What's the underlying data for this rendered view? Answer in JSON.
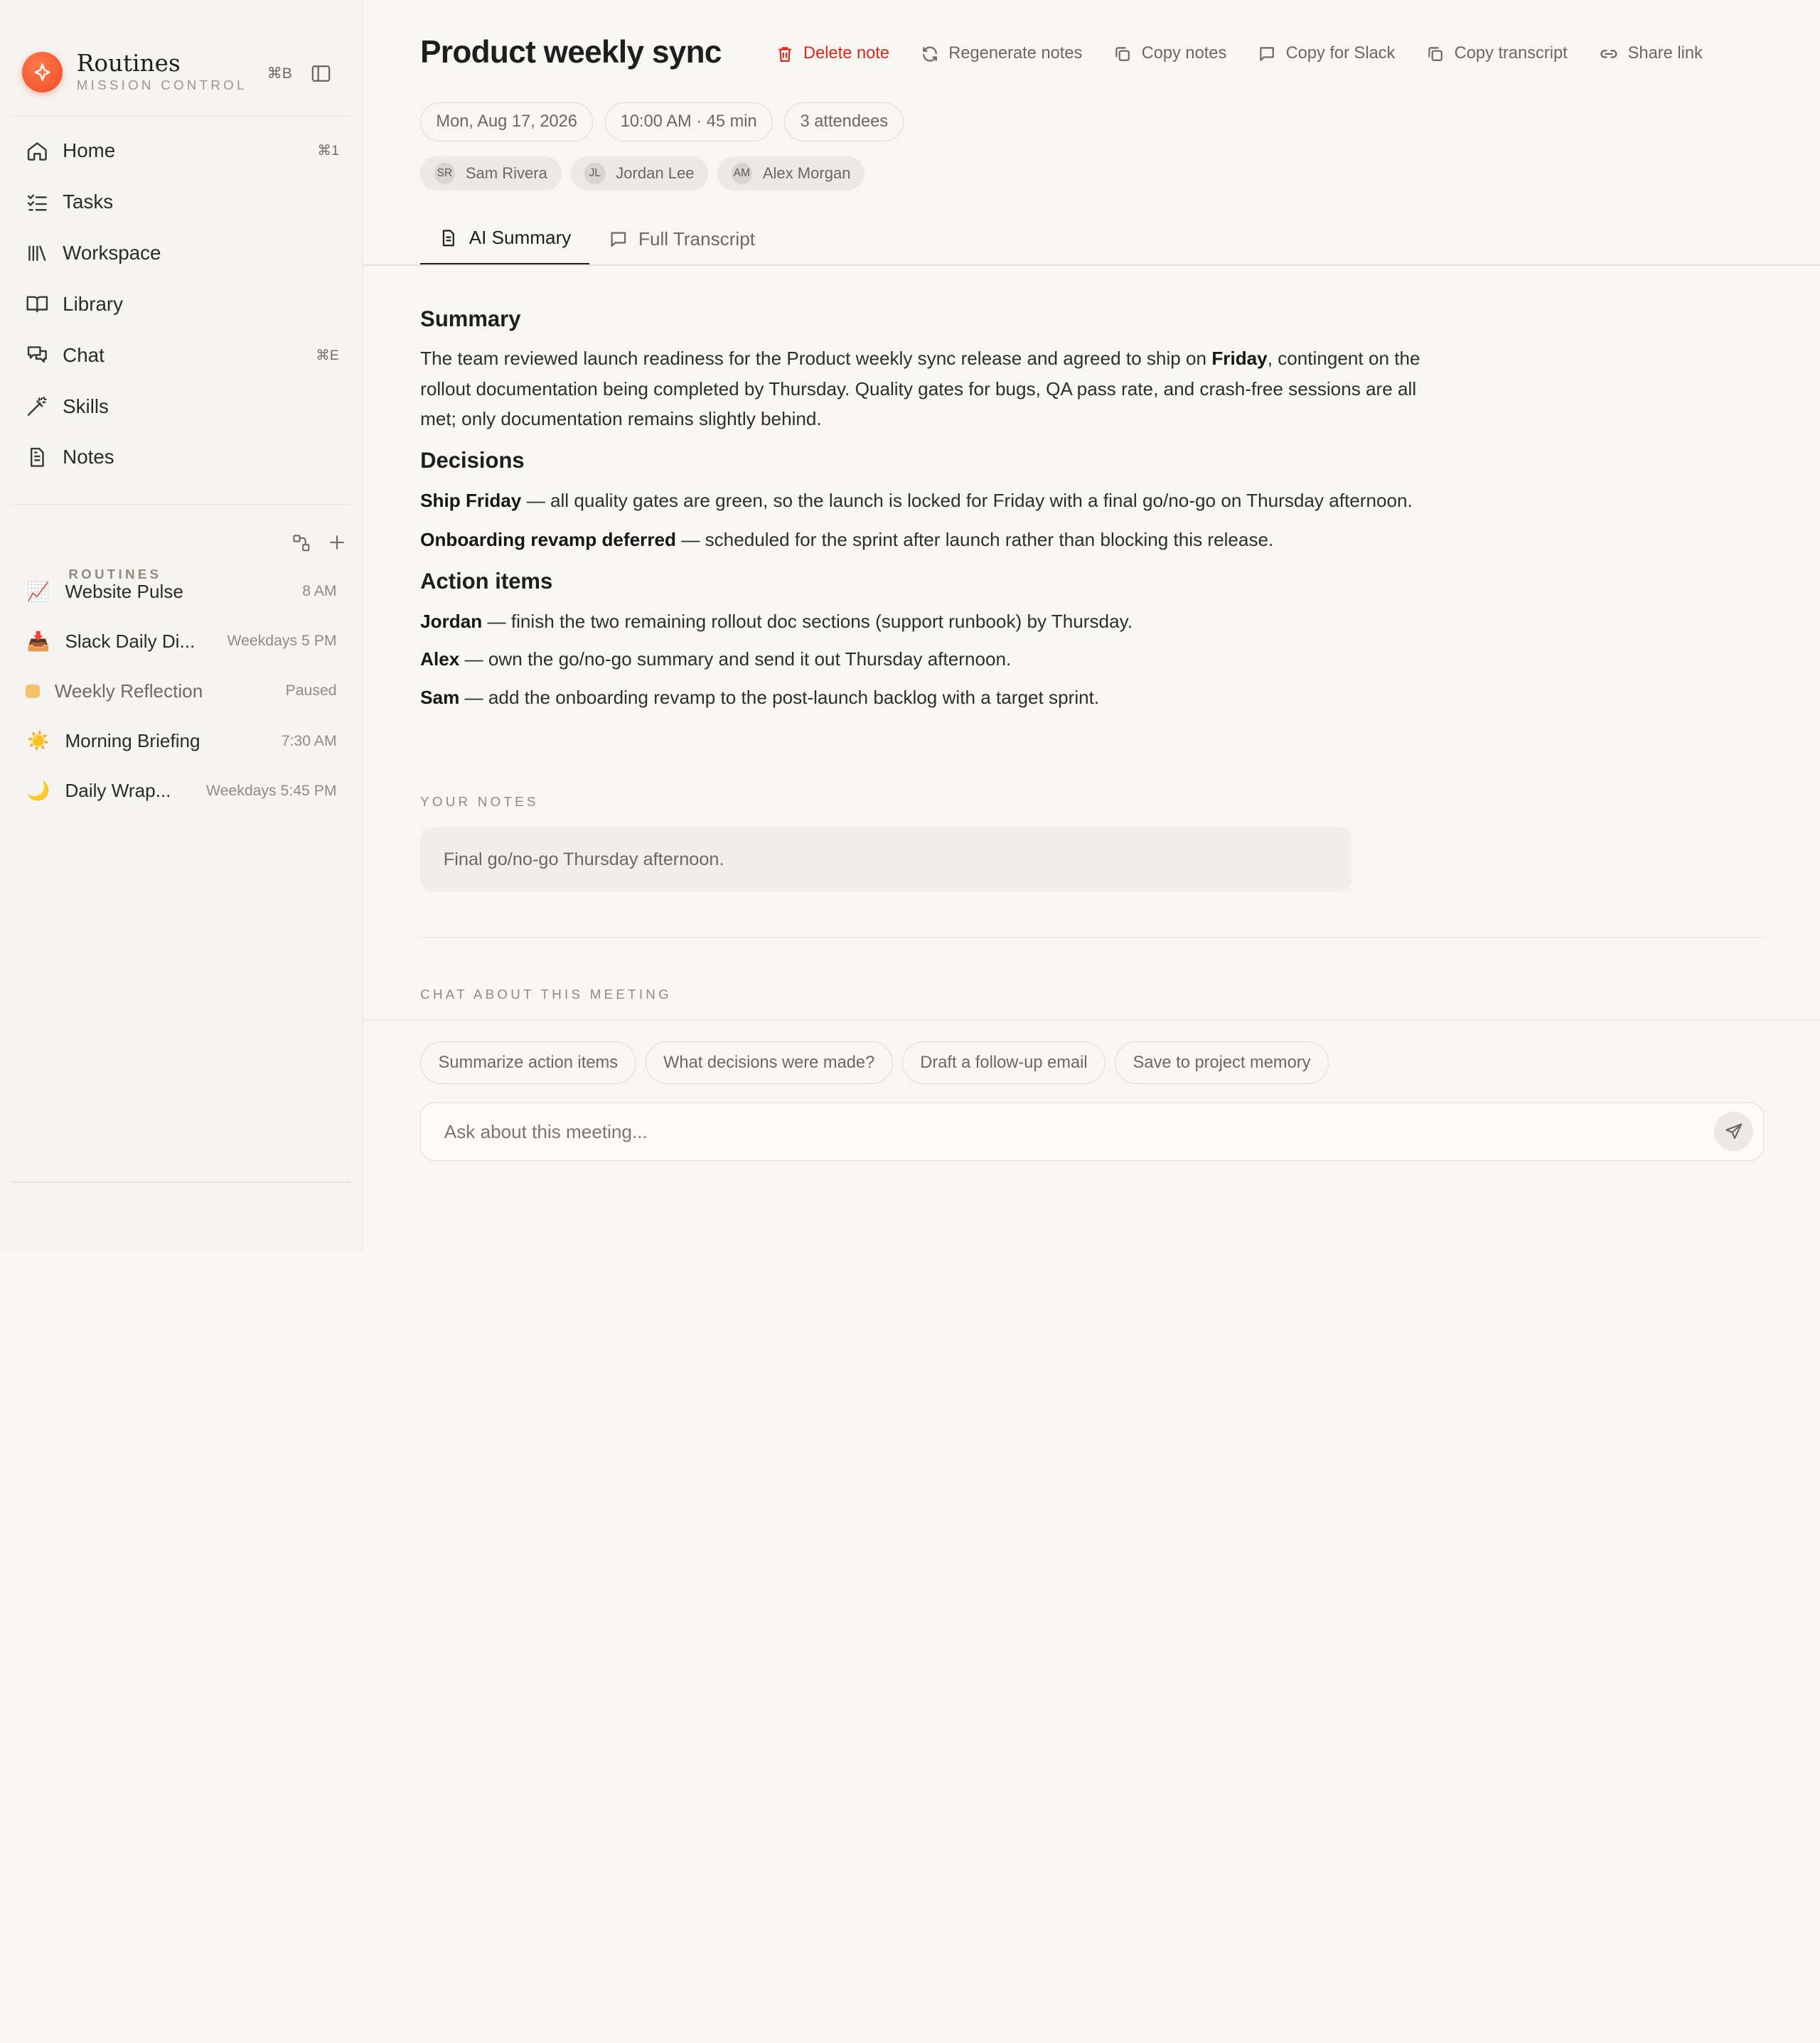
{
  "brand": {
    "name": "Routines",
    "subtitle": "MISSION CONTROL",
    "shortcut": "⌘B"
  },
  "nav": [
    {
      "label": "Home",
      "kbd": "⌘1",
      "icon": "home-icon"
    },
    {
      "label": "Tasks",
      "kbd": "",
      "icon": "tasks-icon"
    },
    {
      "label": "Workspace",
      "kbd": "",
      "icon": "workspace-icon"
    },
    {
      "label": "Library",
      "kbd": "",
      "icon": "book-icon"
    },
    {
      "label": "Chat",
      "kbd": "⌘E",
      "icon": "chat-icon"
    },
    {
      "label": "Skills",
      "kbd": "",
      "icon": "wand-icon"
    },
    {
      "label": "Notes",
      "kbd": "",
      "icon": "note-icon"
    }
  ],
  "routines": {
    "title": "ROUTINES",
    "items": [
      {
        "emoji": "📈",
        "name": "Website Pulse",
        "meta": "8 AM"
      },
      {
        "emoji": "📥",
        "name": "Slack Daily Di...",
        "meta": "Weekdays 5 PM"
      },
      {
        "emoji": "",
        "name": "Weekly Reflection",
        "meta": "Paused"
      },
      {
        "emoji": "☀️",
        "name": "Morning Briefing",
        "meta": "7:30 AM"
      },
      {
        "emoji": "🌙",
        "name": "Daily Wrap...",
        "meta": "Weekdays 5:45 PM"
      }
    ]
  },
  "meeting": {
    "title": "Product weekly sync",
    "date": "Mon, Aug 17, 2026",
    "time": "10:00 AM · 45 min",
    "attendees_count": "3 attendees",
    "attendees": [
      {
        "initials": "SR",
        "name": "Sam Rivera"
      },
      {
        "initials": "JL",
        "name": "Jordan Lee"
      },
      {
        "initials": "AM",
        "name": "Alex Morgan"
      }
    ]
  },
  "toolbar": {
    "delete": "Delete note",
    "regenerate": "Regenerate notes",
    "copy_notes": "Copy notes",
    "copy_slack": "Copy for Slack",
    "copy_transcript": "Copy transcript",
    "share": "Share link"
  },
  "tabs": {
    "summary": "AI Summary",
    "transcript": "Full Transcript"
  },
  "summary": {
    "h_summary": "Summary",
    "p1_a": "The team reviewed launch readiness for the Product weekly sync release and agreed to ship on ",
    "p1_b": "Friday",
    "p1_c": ", contingent on the rollout documentation being completed by Thursday. Quality gates for bugs, QA pass rate, and crash-free sessions are all met; only documentation remains slightly behind.",
    "h_decisions": "Decisions",
    "d1_b": "Ship Friday",
    "d1_t": " — all quality gates are green, so the launch is locked for Friday with a final go/no-go on Thursday afternoon.",
    "d2_b": "Onboarding revamp deferred",
    "d2_t": " — scheduled for the sprint after launch rather than blocking this release.",
    "h_actions": "Action items",
    "a1_b": "Jordan",
    "a1_t": " — finish the two remaining rollout doc sections (support runbook) by Thursday.",
    "a2_b": "Alex",
    "a2_t": " — own the go/no-go summary and send it out Thursday afternoon.",
    "a3_b": "Sam",
    "a3_t": " — add the onboarding revamp to the post-launch backlog with a target sprint."
  },
  "notes": {
    "label": "YOUR NOTES",
    "value": "Final go/no-go Thursday afternoon."
  },
  "chat": {
    "label": "CHAT ABOUT THIS MEETING",
    "suggestions": [
      "Summarize action items",
      "What decisions were made?",
      "Draft a follow-up email",
      "Save to project memory"
    ],
    "placeholder": "Ask about this meeting..."
  },
  "colors": {
    "accent": "#ef4a26",
    "danger": "#d9281f",
    "paused": "#f3c26b"
  }
}
